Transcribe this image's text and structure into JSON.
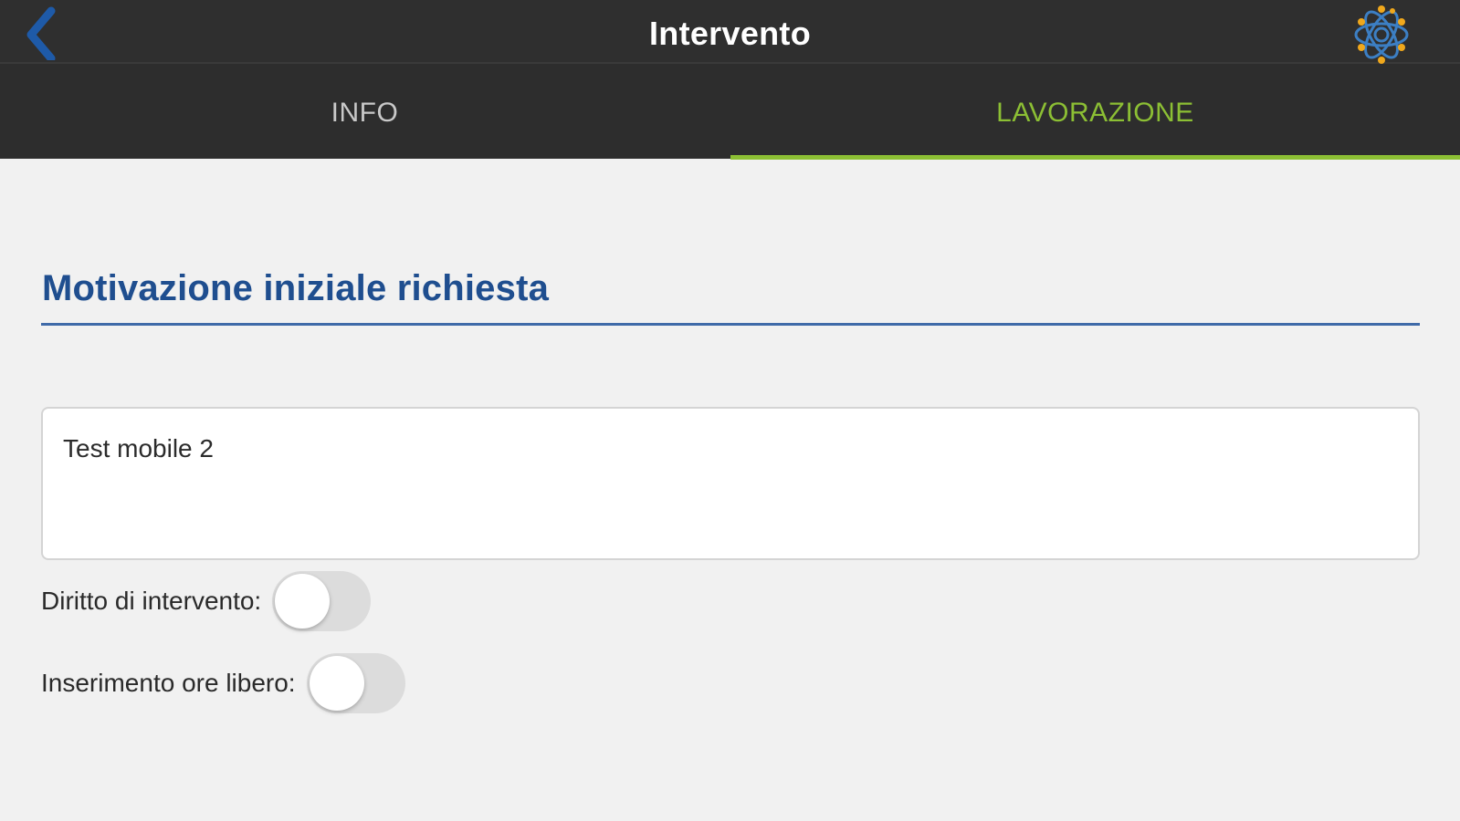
{
  "header": {
    "title": "Intervento",
    "back_icon": "chevron-left-icon",
    "logo_icon": "atom-logo-icon"
  },
  "tabs": [
    {
      "label": "INFO",
      "active": false
    },
    {
      "label": "LAVORAZIONE",
      "active": true
    }
  ],
  "section": {
    "title": "Motivazione iniziale richiesta",
    "note_value": "Test mobile 2"
  },
  "toggles": [
    {
      "label": "Diritto di intervento:",
      "on": false
    },
    {
      "label": "Inserimento ore libero:",
      "on": false
    }
  ],
  "colors": {
    "accent_green": "#8cbf34",
    "title_blue": "#1f4e8f",
    "back_blue": "#1e5aa8",
    "navbar": "#2f2f2f"
  }
}
